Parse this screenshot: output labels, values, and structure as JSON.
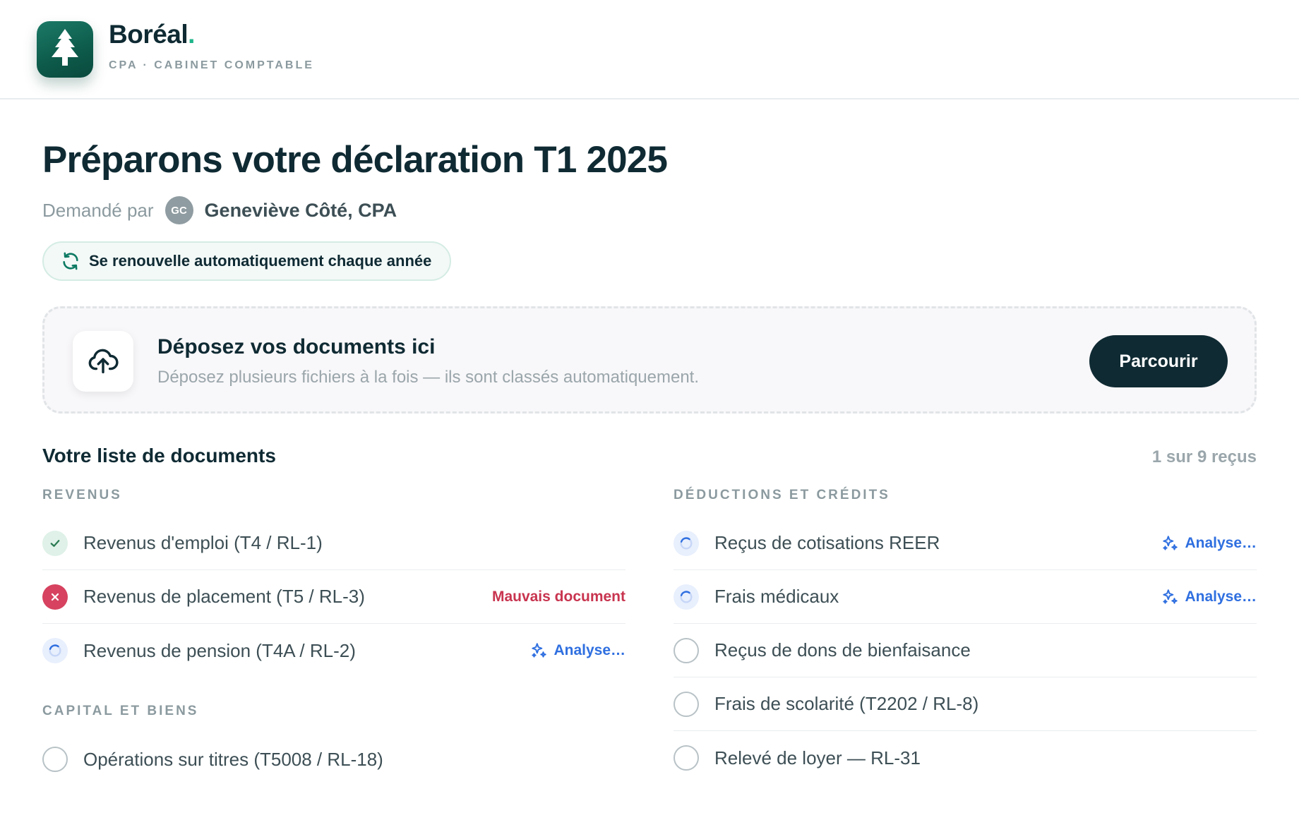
{
  "brand": {
    "name": "Boréal",
    "dot": ".",
    "subtitle": "CPA · CABINET COMPTABLE"
  },
  "page": {
    "title": "Préparons votre déclaration T1 2025",
    "requested_by_label": "Demandé par",
    "requester_initials": "GC",
    "requester_name": "Geneviève Côté, CPA",
    "renew_label": "Se renouvelle automatiquement chaque année"
  },
  "dropzone": {
    "title": "Déposez vos documents ici",
    "subtitle": "Déposez plusieurs fichiers à la fois — ils sont classés automatiquement.",
    "browse_label": "Parcourir"
  },
  "checklist": {
    "title": "Votre liste de documents",
    "count": "1 sur 9 reçus",
    "income": {
      "label": "REVENUS",
      "items": [
        {
          "label": "Revenus d'emploi (T4 / RL-1)",
          "status": "received",
          "tag": ""
        },
        {
          "label": "Revenus de placement (T5 / RL-3)",
          "status": "wrong",
          "tag": "Mauvais document"
        },
        {
          "label": "Revenus de pension (T4A / RL-2)",
          "status": "analyzing",
          "tag": "Analyse…"
        }
      ]
    },
    "capital": {
      "label": "CAPITAL ET BIENS",
      "items": [
        {
          "label": "Opérations sur titres (T5008 / RL-18)",
          "status": "pending",
          "tag": ""
        }
      ]
    },
    "deductions": {
      "label": "DÉDUCTIONS ET CRÉDITS",
      "items": [
        {
          "label": "Reçus de cotisations REER",
          "status": "analyzing",
          "tag": "Analyse…"
        },
        {
          "label": "Frais médicaux",
          "status": "analyzing",
          "tag": "Analyse…"
        },
        {
          "label": "Reçus de dons de bienfaisance",
          "status": "pending",
          "tag": ""
        },
        {
          "label": "Frais de scolarité (T2202 / RL-8)",
          "status": "pending",
          "tag": ""
        },
        {
          "label": "Relevé de loyer — RL-31",
          "status": "pending",
          "tag": ""
        }
      ]
    }
  },
  "colors": {
    "brand_green": "#0d5a4a",
    "accent_dot": "#1fb58a",
    "dark": "#0f2a33",
    "error": "#d6425f",
    "analyzing": "#2f6fe0"
  },
  "icons": {
    "logo": "pine-tree-icon",
    "renew": "refresh-icon",
    "upload": "cloud-upload-icon",
    "received": "check-icon",
    "wrong": "x-icon",
    "analyzing": "spinner-icon",
    "sparkle": "sparkles-icon"
  }
}
